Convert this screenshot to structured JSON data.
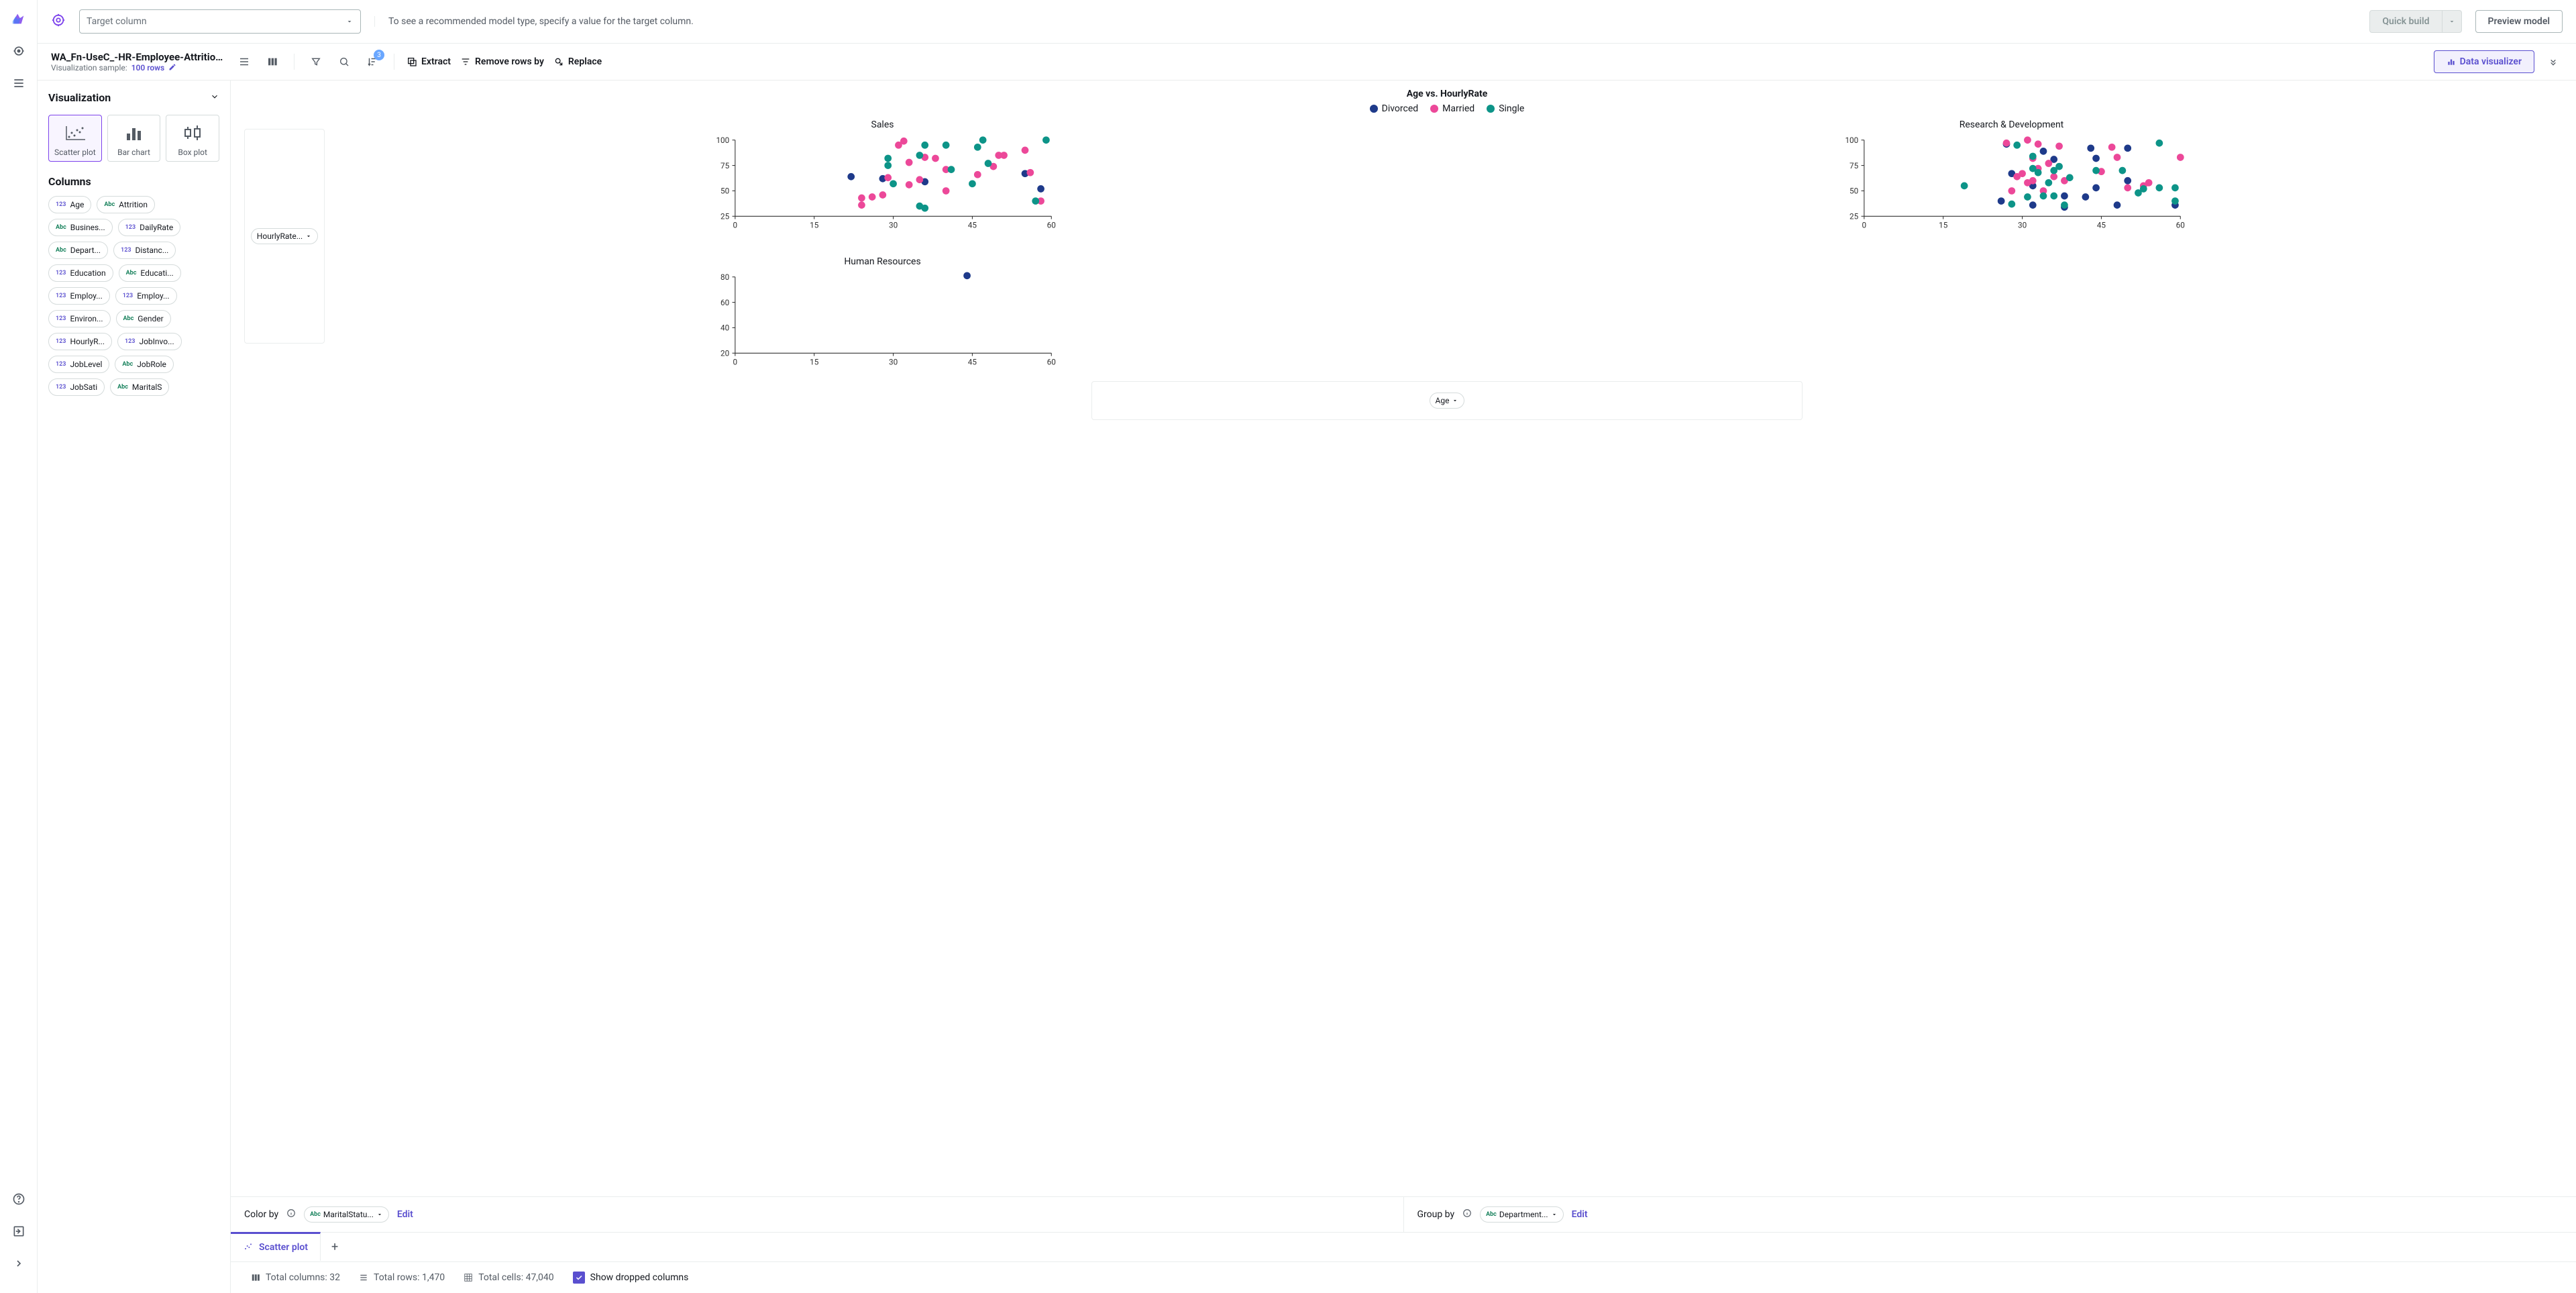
{
  "topbar": {
    "target_placeholder": "Target column",
    "hint": "To see a recommended model type, specify a value for the target column.",
    "quick_build": "Quick build",
    "preview_model": "Preview model"
  },
  "secondbar": {
    "title": "WA_Fn-UseC_-HR-Employee-Attrition...",
    "sample_label": "Visualization sample:",
    "sample_value": "100 rows",
    "badge_count": "3",
    "extract": "Extract",
    "remove_rows": "Remove rows by",
    "replace": "Replace",
    "data_visualizer": "Data visualizer"
  },
  "viz_panel": {
    "heading": "Visualization",
    "types": [
      "Scatter plot",
      "Bar chart",
      "Box plot"
    ],
    "columns_heading": "Columns",
    "columns": [
      {
        "t": "123",
        "n": "Age"
      },
      {
        "t": "Abc",
        "n": "Attrition"
      },
      {
        "t": "Abc",
        "n": "Busines..."
      },
      {
        "t": "123",
        "n": "DailyRate"
      },
      {
        "t": "Abc",
        "n": "Depart..."
      },
      {
        "t": "123",
        "n": "Distanc..."
      },
      {
        "t": "123",
        "n": "Education"
      },
      {
        "t": "Abc",
        "n": "Educati..."
      },
      {
        "t": "123",
        "n": "Employ..."
      },
      {
        "t": "123",
        "n": "Employ..."
      },
      {
        "t": "123",
        "n": "Environ..."
      },
      {
        "t": "Abc",
        "n": "Gender"
      },
      {
        "t": "123",
        "n": "HourlyR..."
      },
      {
        "t": "123",
        "n": "JobInvo..."
      },
      {
        "t": "123",
        "n": "JobLevel"
      },
      {
        "t": "Abc",
        "n": "JobRole"
      },
      {
        "t": "123",
        "n": "JobSati"
      },
      {
        "t": "Abc",
        "n": "MaritalS"
      }
    ]
  },
  "chart": {
    "title": "Age vs. HourlyRate",
    "legend": [
      {
        "label": "Divorced",
        "color": "#1e3a8a"
      },
      {
        "label": "Married",
        "color": "#ec4899"
      },
      {
        "label": "Single",
        "color": "#0d9488"
      }
    ],
    "y_label": "HourlyRate...",
    "x_label": "Age",
    "facets": [
      "Sales",
      "Research & Development",
      "Human Resources"
    ]
  },
  "controls": {
    "color_by": "Color by",
    "color_value": "MaritalStatu...",
    "group_by": "Group by",
    "group_value": "Department...",
    "edit": "Edit"
  },
  "tabs": {
    "active": "Scatter plot"
  },
  "status": {
    "cols": "Total columns: 32",
    "rows": "Total rows: 1,470",
    "cells": "Total cells: 47,040",
    "show_dropped": "Show dropped columns"
  },
  "chart_data": {
    "type": "scatter",
    "title": "Age vs. HourlyRate",
    "xlabel": "Age",
    "ylabel": "HourlyRate",
    "xlim": [
      0,
      60
    ],
    "ylim": [
      0,
      100
    ],
    "color_by": "MaritalStatus",
    "group_by": "Department",
    "facets": {
      "Sales": {
        "ylim": [
          25,
          100
        ],
        "series": {
          "Divorced": [
            [
              22,
              64
            ],
            [
              28,
              62
            ],
            [
              36,
              59
            ],
            [
              55,
              67
            ],
            [
              58,
              52
            ]
          ],
          "Married": [
            [
              24,
              36
            ],
            [
              24,
              43
            ],
            [
              26,
              44
            ],
            [
              28,
              46
            ],
            [
              29,
              63
            ],
            [
              31,
              95
            ],
            [
              32,
              99
            ],
            [
              33,
              78
            ],
            [
              33,
              56
            ],
            [
              35,
              61
            ],
            [
              36,
              83
            ],
            [
              38,
              82
            ],
            [
              40,
              50
            ],
            [
              40,
              71
            ],
            [
              46,
              66
            ],
            [
              49,
              74
            ],
            [
              50,
              85
            ],
            [
              51,
              85
            ],
            [
              55,
              90
            ],
            [
              56,
              68
            ],
            [
              58,
              40
            ]
          ],
          "Single": [
            [
              29,
              82
            ],
            [
              29,
              75
            ],
            [
              30,
              57
            ],
            [
              35,
              35
            ],
            [
              35,
              85
            ],
            [
              36,
              95
            ],
            [
              36,
              33
            ],
            [
              40,
              95
            ],
            [
              41,
              71
            ],
            [
              45,
              57
            ],
            [
              46,
              93
            ],
            [
              47,
              100
            ],
            [
              48,
              77
            ],
            [
              57,
              40
            ],
            [
              59,
              100
            ]
          ]
        }
      },
      "Research & Development": {
        "ylim": [
          25,
          100
        ],
        "series": {
          "Divorced": [
            [
              26,
              40
            ],
            [
              27,
              96
            ],
            [
              28,
              67
            ],
            [
              32,
              55
            ],
            [
              32,
              36
            ],
            [
              34,
              89
            ],
            [
              36,
              81
            ],
            [
              38,
              34
            ],
            [
              38,
              45
            ],
            [
              42,
              44
            ],
            [
              43,
              92
            ],
            [
              44,
              53
            ],
            [
              44,
              82
            ],
            [
              48,
              36
            ],
            [
              50,
              92
            ],
            [
              50,
              60
            ],
            [
              59,
              36
            ]
          ],
          "Married": [
            [
              27,
              97
            ],
            [
              28,
              50
            ],
            [
              29,
              64
            ],
            [
              30,
              67
            ],
            [
              31,
              58
            ],
            [
              31,
              100
            ],
            [
              32,
              82
            ],
            [
              32,
              60
            ],
            [
              33,
              72
            ],
            [
              33,
              96
            ],
            [
              34,
              50
            ],
            [
              35,
              77
            ],
            [
              36,
              64
            ],
            [
              37,
              94
            ],
            [
              38,
              60
            ],
            [
              45,
              69
            ],
            [
              47,
              93
            ],
            [
              48,
              83
            ],
            [
              50,
              53
            ],
            [
              53,
              55
            ],
            [
              54,
              58
            ],
            [
              60,
              83
            ]
          ],
          "Single": [
            [
              19,
              55
            ],
            [
              28,
              37
            ],
            [
              29,
              95
            ],
            [
              31,
              44
            ],
            [
              32,
              84
            ],
            [
              32,
              72
            ],
            [
              33,
              68
            ],
            [
              34,
              45
            ],
            [
              35,
              58
            ],
            [
              36,
              45
            ],
            [
              36,
              70
            ],
            [
              37,
              74
            ],
            [
              38,
              36
            ],
            [
              39,
              63
            ],
            [
              44,
              70
            ],
            [
              49,
              70
            ],
            [
              52,
              48
            ],
            [
              53,
              52
            ],
            [
              56,
              97
            ],
            [
              56,
              53
            ],
            [
              59,
              40
            ],
            [
              59,
              53
            ]
          ]
        }
      },
      "Human Resources": {
        "ylim": [
          20,
          80
        ],
        "series": {
          "Divorced": [
            [
              44,
              81
            ]
          ],
          "Married": [],
          "Single": []
        }
      }
    }
  }
}
